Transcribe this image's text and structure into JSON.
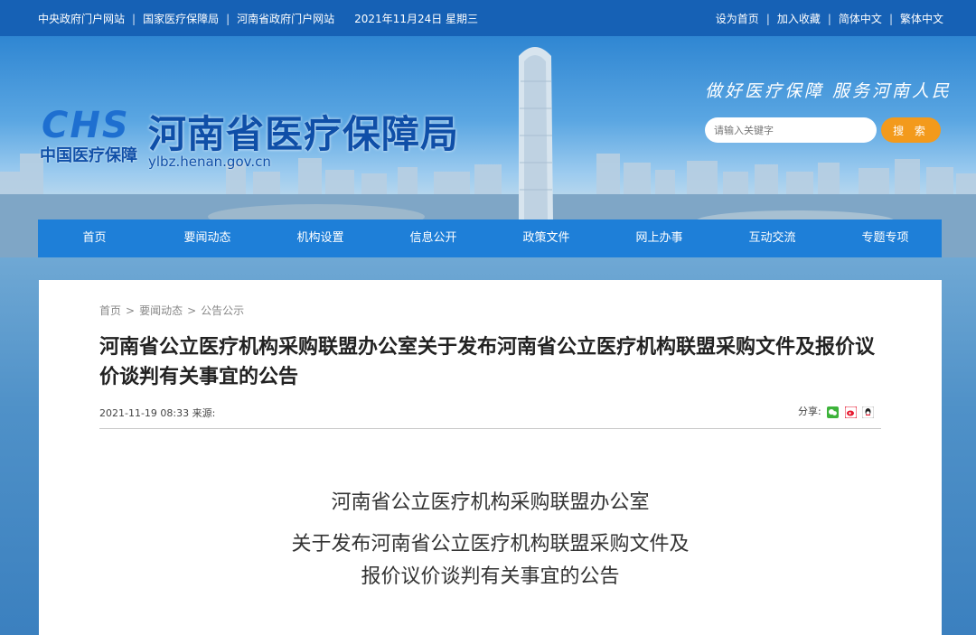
{
  "topbar": {
    "links_left": [
      "中央政府门户网站",
      "国家医疗保障局",
      "河南省政府门户网站"
    ],
    "date": "2021年11月24日 星期三",
    "links_right": [
      "设为首页",
      "加入收藏",
      "简体中文",
      "繁体中文"
    ]
  },
  "header": {
    "logo_mark": "CHS",
    "logo_cn": "中国医疗保障",
    "site_title": "河南省医疗保障局",
    "site_url": "ylbz.henan.gov.cn",
    "slogan": "做好医疗保障  服务河南人民",
    "search_placeholder": "请输入关键字",
    "search_button": "搜  索"
  },
  "nav": [
    "首页",
    "要闻动态",
    "机构设置",
    "信息公开",
    "政策文件",
    "网上办事",
    "互动交流",
    "专题专项"
  ],
  "breadcrumb": [
    "首页",
    "要闻动态",
    "公告公示"
  ],
  "article": {
    "title": "河南省公立医疗机构采购联盟办公室关于发布河南省公立医疗机构联盟采购文件及报价议价谈判有关事宜的公告",
    "meta": "2021-11-19 08:33 来源:",
    "share_label": "分享:",
    "body_lines": [
      "河南省公立医疗机构采购联盟办公室",
      "关于发布河南省公立医疗机构联盟采购文件及",
      "报价议价谈判有关事宜的公告"
    ]
  },
  "colors": {
    "topbar": "#1661b5",
    "nav": "#1e7fd8",
    "search_button": "#f39a1c",
    "logo": "#0f4fa8"
  }
}
